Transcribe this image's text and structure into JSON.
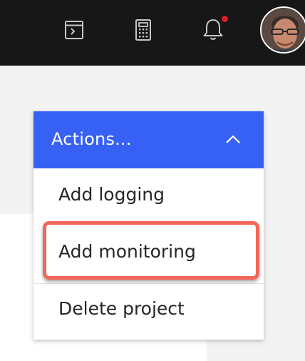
{
  "header": {
    "icons": [
      "terminal-icon",
      "calculator-icon",
      "notification-bell-icon"
    ],
    "notification_indicator_color": "#da1e28",
    "avatar_alt": "user avatar"
  },
  "dropdown": {
    "title": "Actions...",
    "header_color": "#3761f5",
    "items": [
      {
        "label": "Add logging"
      },
      {
        "label": "Add monitoring",
        "highlighted": true
      },
      {
        "label": "Delete project"
      }
    ]
  },
  "highlight_color": "#f2675a"
}
